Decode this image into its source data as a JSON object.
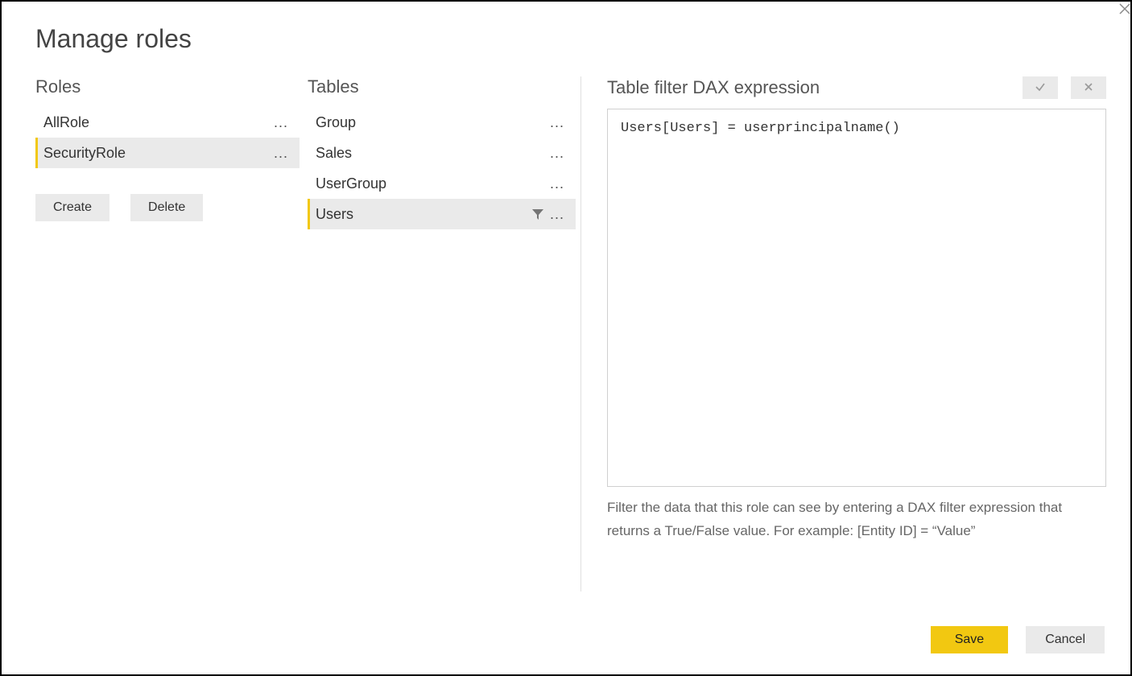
{
  "title": "Manage roles",
  "roles": {
    "header": "Roles",
    "items": [
      {
        "label": "AllRole",
        "selected": false
      },
      {
        "label": "SecurityRole",
        "selected": true
      }
    ],
    "create_label": "Create",
    "delete_label": "Delete"
  },
  "tables": {
    "header": "Tables",
    "items": [
      {
        "label": "Group",
        "selected": false,
        "has_filter": false
      },
      {
        "label": "Sales",
        "selected": false,
        "has_filter": false
      },
      {
        "label": "UserGroup",
        "selected": false,
        "has_filter": false
      },
      {
        "label": "Users",
        "selected": true,
        "has_filter": true
      }
    ]
  },
  "dax": {
    "header": "Table filter DAX expression",
    "expression": "Users[Users] = userprincipalname()",
    "hint": "Filter the data that this role can see by entering a DAX filter expression that returns a True/False value. For example: [Entity ID] = “Value”",
    "apply_glyph": "✓",
    "revert_glyph": "✕"
  },
  "footer": {
    "save_label": "Save",
    "cancel_label": "Cancel"
  }
}
